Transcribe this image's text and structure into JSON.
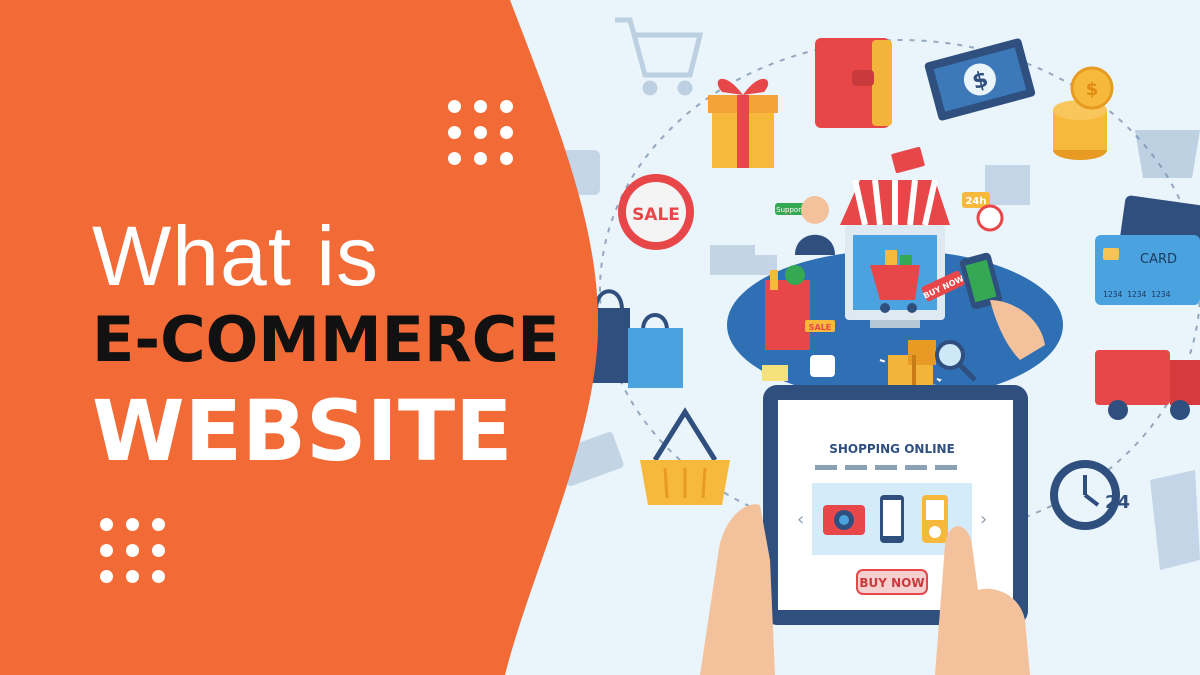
{
  "headline": {
    "line1": "What is",
    "line2": "E-COMMERCE",
    "line3": "WEBSITE"
  },
  "illustration": {
    "sale_tag": "SALE",
    "card_label": "CARD",
    "card_number": "1234 1234 1234",
    "hours_badge": "24h",
    "clock_label": "24",
    "screen_title": "SHOPPING ONLINE",
    "screen_button": "BUY NOW",
    "cart_badge": "BUY NOW",
    "support_label": "Support",
    "bag_sale": "SALE",
    "dollar": "$"
  },
  "colors": {
    "panel": "#f26a35",
    "background": "#eaf4fb",
    "navy": "#2f4f7f",
    "accent_red": "#e8474a",
    "accent_yellow": "#f6b93b"
  }
}
